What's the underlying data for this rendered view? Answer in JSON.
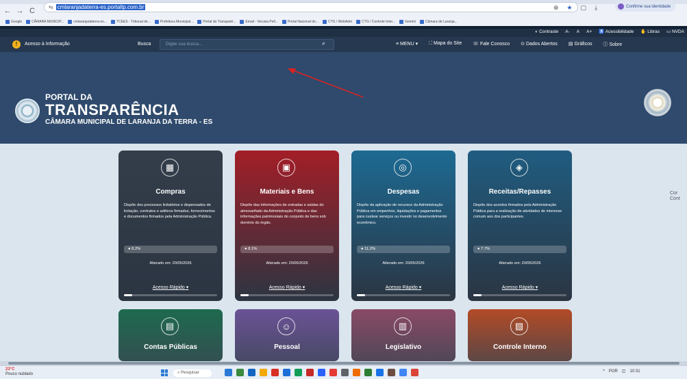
{
  "browser": {
    "url": "cmlaranjadaterra-es.portaltp.com.br",
    "confirm_label": "Confirme sua identidade",
    "bookmarks": [
      "Google",
      "CÂMARA MUNICIP...",
      "cmlaranjadaterra-es...",
      "TCEES - Tribunal de...",
      "Prefeitura Municipal...",
      "Portal da Transparê...",
      "Email - Verusia Pell...",
      "Portal Nacional do...",
      "CTG / WebAdm",
      "CTG / Controle Inter...",
      "Gemini",
      "Câmara de Laranja..."
    ]
  },
  "accessibility": {
    "contraste": "Contraste",
    "a_minus": "A-",
    "a": "A",
    "a_plus": "A+",
    "acessibilidade": "Acessibilidade",
    "libras": "Libras",
    "nvda": "NVDA"
  },
  "nav": {
    "acesso_info": "Acesso à Informação",
    "busca_label": "Busca",
    "search_placeholder": "Digite sua busca...",
    "menu": "MENU",
    "mapa": "Mapa do Site",
    "fale": "Fale Conosco",
    "dados": "Dados Abertos",
    "graficos": "Gráficos",
    "sobre": "Sobre"
  },
  "header": {
    "portal_da": "PORTAL DA",
    "transparencia": "TRANSPARÊNCIA",
    "camara": "CÂMARA MUNICIPAL DE LARANJA DA TERRA - ES"
  },
  "cards": [
    {
      "title": "Compras",
      "desc": "Dispõe dos processos licitatórios e dispensados de licitação, contratos e aditivos firmados, fornecimentos e documentos firmados pela Administração Pública.",
      "views": "8.2%",
      "altered": "Alterado em: 20/05/2026",
      "quick": "Acesso Rápido",
      "color": "#343e4b",
      "icon": "cart-icon"
    },
    {
      "title": "Materiais e Bens",
      "desc": "Dispõe das informações de entradas e saídas do almoxarifado da Administração Pública e das informações patrimoniais do conjunto de bens sob domínio do órgão.",
      "views": "8.1%",
      "altered": "Alterado em: 20/05/2026",
      "quick": "Acesso Rápido",
      "color": "#a31e27",
      "icon": "box-icon"
    },
    {
      "title": "Despesas",
      "desc": "Dispõe da aplicação de recursos da Administração Pública em empenhos, liquidações e pagamentos para custear serviços ou investir no desenvolvimento econômico.",
      "views": "11.2%",
      "altered": "Alterado em: 20/05/2026",
      "quick": "Acesso Rápido",
      "color": "#1d6a93",
      "icon": "coins-icon"
    },
    {
      "title": "Receitas/Repasses",
      "desc": "Dispõe dos acordos firmados pela Administração Pública para a realização de atividades de interesse comum aos dos participantes.",
      "views": "7.7%",
      "altered": "Alterado em: 20/05/2026",
      "quick": "Acesso Rápido",
      "color": "#1f5c80",
      "icon": "money-icon"
    }
  ],
  "cards2": [
    {
      "title": "Contas Públicas",
      "color": "#1e6a4f",
      "icon": "ledger-icon"
    },
    {
      "title": "Pessoal",
      "color": "#6b5296",
      "icon": "people-icon"
    },
    {
      "title": "Legislativo",
      "color": "#8a4a66",
      "icon": "document-icon"
    },
    {
      "title": "Controle Interno",
      "color": "#b34b26",
      "icon": "chart-icon"
    }
  ],
  "broken_img": "Cor Cont",
  "taskbar": {
    "weather_temp": "23°C",
    "weather_desc": "Pouco nublado",
    "search": "Pesquisar",
    "lang": "POR",
    "time": "10:31"
  }
}
